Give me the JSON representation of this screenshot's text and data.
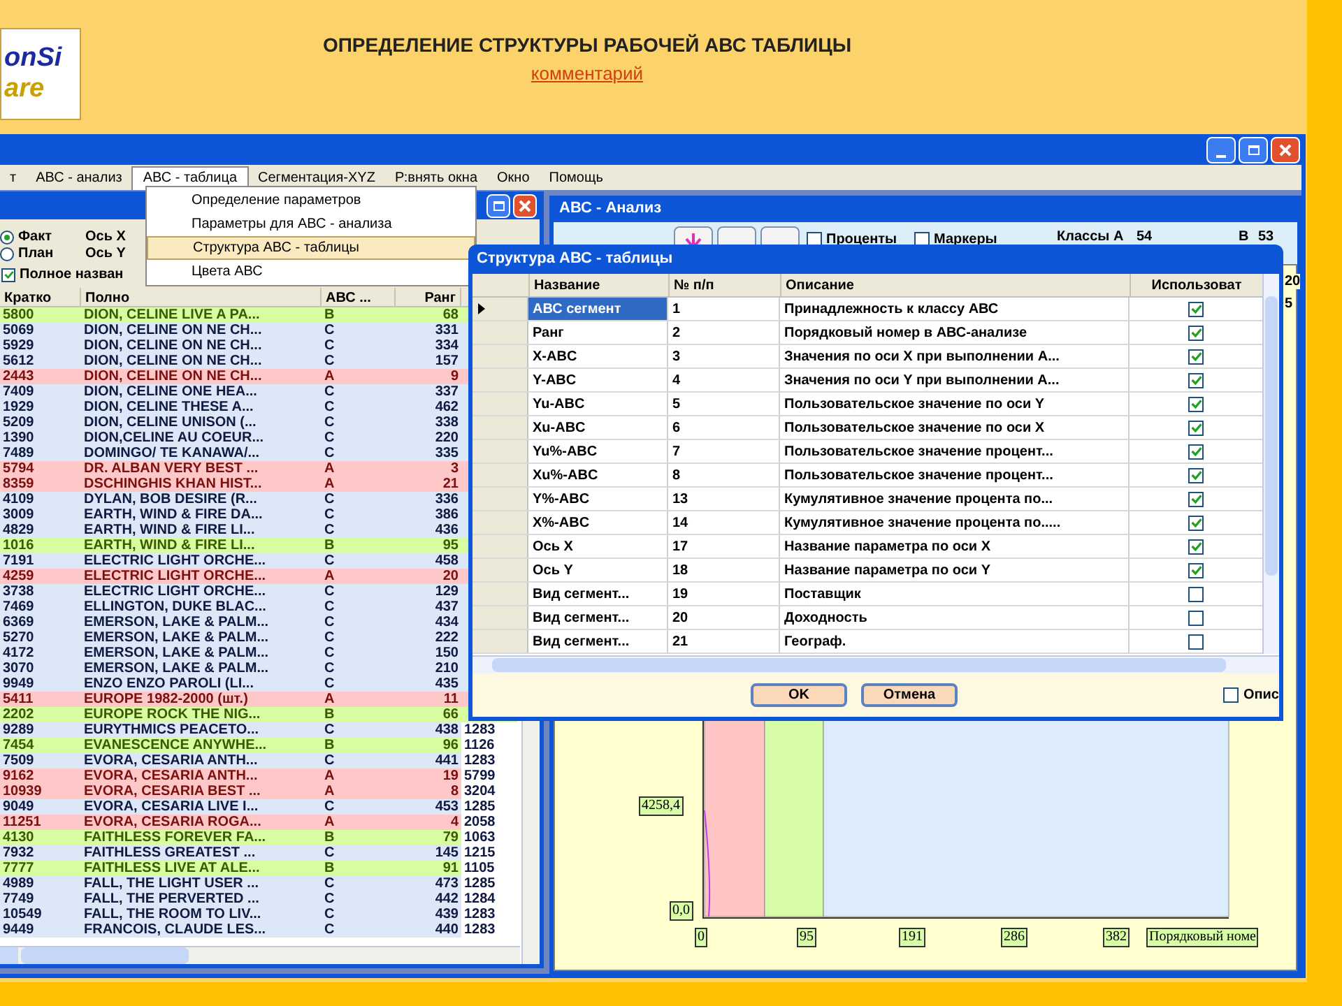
{
  "banner": {
    "logo_lines": [
      "onSi",
      "are"
    ],
    "title": "ОПРЕДЕЛЕНИЕ СТРУКТУРЫ РАБОЧЕЙ АВС ТАБЛИЦЫ",
    "link": "комментарий"
  },
  "menu": [
    {
      "label": "т",
      "selected": false
    },
    {
      "label": "АВС - анализ",
      "selected": false
    },
    {
      "label": "АВС - таблица",
      "selected": true
    },
    {
      "label": "Сегментация-XYZ",
      "selected": false
    },
    {
      "label": "Р:внять окна",
      "selected": false
    },
    {
      "label": "Окно",
      "selected": false
    },
    {
      "label": "Помощь",
      "selected": false
    }
  ],
  "dropdown": [
    {
      "label": "Определение параметров",
      "selected": false
    },
    {
      "label": "Параметры для АВС - анализа",
      "selected": false
    },
    {
      "label": "Структура АВС - таблицы",
      "selected": true
    },
    {
      "label": "Цвета АВС",
      "selected": false
    }
  ],
  "left_window": {
    "radios": [
      {
        "label": "Факт",
        "selected": true
      },
      {
        "label": "План",
        "selected": false
      }
    ],
    "axes": [
      "Ось X",
      "Ось Y"
    ],
    "full_name": {
      "label": "Полное назван",
      "checked": true
    },
    "columns": [
      "Кратко",
      "Полно",
      "АВС ...",
      "Ранг"
    ],
    "rows": [
      {
        "kind": "b",
        "cells": [
          "5800",
          "DION, CELINE LIVE A PA...",
          "B",
          "68"
        ]
      },
      {
        "kind": "c",
        "cells": [
          "5069",
          "DION, CELINE ON NE CH...",
          "C",
          "331"
        ]
      },
      {
        "kind": "c",
        "cells": [
          "5929",
          "DION, CELINE ON NE CH...",
          "C",
          "334"
        ]
      },
      {
        "kind": "c",
        "cells": [
          "5612",
          "DION, CELINE ON NE CH...",
          "C",
          "157"
        ]
      },
      {
        "kind": "a",
        "cells": [
          "2443",
          "DION, CELINE ON NE CH...",
          "A",
          "9"
        ]
      },
      {
        "kind": "c",
        "cells": [
          "7409",
          "DION, CELINE ONE HEA...",
          "C",
          "337"
        ]
      },
      {
        "kind": "c",
        "cells": [
          "1929",
          "DION, CELINE THESE A...",
          "C",
          "462"
        ]
      },
      {
        "kind": "c",
        "cells": [
          "5209",
          "DION, CELINE UNISON (...",
          "C",
          "338"
        ]
      },
      {
        "kind": "c",
        "cells": [
          "1390",
          "DION,CELINE AU COEUR...",
          "C",
          "220"
        ]
      },
      {
        "kind": "c",
        "cells": [
          "7489",
          "DOMINGO/ TE KANAWA/...",
          "C",
          "335"
        ]
      },
      {
        "kind": "a",
        "cells": [
          "5794",
          "DR. ALBAN VERY BEST ...",
          "A",
          "3"
        ]
      },
      {
        "kind": "a",
        "cells": [
          "8359",
          "DSCHINGHIS KHAN HIST...",
          "A",
          "21"
        ]
      },
      {
        "kind": "c",
        "cells": [
          "4109",
          "DYLAN, BOB DESIRE (R...",
          "C",
          "336"
        ]
      },
      {
        "kind": "c",
        "cells": [
          "3009",
          "EARTH, WIND & FIRE DA...",
          "C",
          "386"
        ]
      },
      {
        "kind": "c",
        "cells": [
          "4829",
          "EARTH, WIND & FIRE LI...",
          "C",
          "436"
        ]
      },
      {
        "kind": "b",
        "cells": [
          "1016",
          "EARTH, WIND & FIRE LI...",
          "B",
          "95"
        ]
      },
      {
        "kind": "c",
        "cells": [
          "7191",
          "ELECTRIC LIGHT ORCHE...",
          "C",
          "458"
        ]
      },
      {
        "kind": "a",
        "cells": [
          "4259",
          "ELECTRIC LIGHT ORCHE...",
          "A",
          "20"
        ]
      },
      {
        "kind": "c",
        "cells": [
          "3738",
          "ELECTRIC LIGHT ORCHE...",
          "C",
          "129"
        ]
      },
      {
        "kind": "c",
        "cells": [
          "7469",
          "ELLINGTON, DUKE BLAC...",
          "C",
          "437"
        ]
      },
      {
        "kind": "c",
        "cells": [
          "6369",
          "EMERSON, LAKE & PALM...",
          "C",
          "434"
        ]
      },
      {
        "kind": "c",
        "cells": [
          "5270",
          "EMERSON, LAKE & PALM...",
          "C",
          "222"
        ]
      },
      {
        "kind": "c",
        "cells": [
          "4172",
          "EMERSON, LAKE & PALM...",
          "C",
          "150"
        ]
      },
      {
        "kind": "c",
        "cells": [
          "3070",
          "EMERSON, LAKE & PALM...",
          "C",
          "210"
        ]
      },
      {
        "kind": "c",
        "cells": [
          "9949",
          "ENZO ENZO PAROLI (LI...",
          "C",
          "435"
        ]
      },
      {
        "kind": "a",
        "cells": [
          "5411",
          "EUROPE 1982-2000 (шт.)",
          "A",
          "11"
        ]
      },
      {
        "kind": "b",
        "cells": [
          "2202",
          "EUROPE ROCK THE NIG...",
          "B",
          "66"
        ]
      },
      {
        "kind": "c",
        "cells": [
          "9289",
          "EURYTHMICS PEACETO...",
          "C",
          "438",
          "1283"
        ]
      },
      {
        "kind": "b",
        "cells": [
          "7454",
          "EVANESCENCE ANYWHE...",
          "B",
          "96",
          "1126"
        ]
      },
      {
        "kind": "c",
        "cells": [
          "7509",
          "EVORA, CESARIA ANTH...",
          "C",
          "441",
          "1283"
        ]
      },
      {
        "kind": "a",
        "cells": [
          "9162",
          "EVORA, CESARIA ANTH...",
          "A",
          "19",
          "5799"
        ]
      },
      {
        "kind": "a",
        "cells": [
          "10939",
          "EVORA, CESARIA BEST ...",
          "A",
          "8",
          "3204"
        ]
      },
      {
        "kind": "c",
        "cells": [
          "9049",
          "EVORA, CESARIA LIVE I...",
          "C",
          "453",
          "1285"
        ]
      },
      {
        "kind": "a",
        "cells": [
          "11251",
          "EVORA, CESARIA ROGA...",
          "A",
          "4",
          "2058"
        ]
      },
      {
        "kind": "b",
        "cells": [
          "4130",
          "FAITHLESS FOREVER FA...",
          "B",
          "79",
          "1063"
        ]
      },
      {
        "kind": "c",
        "cells": [
          "7932",
          "FAITHLESS GREATEST ...",
          "C",
          "145",
          "1215"
        ]
      },
      {
        "kind": "b",
        "cells": [
          "7777",
          "FAITHLESS LIVE AT ALE...",
          "B",
          "91",
          "1105"
        ]
      },
      {
        "kind": "c",
        "cells": [
          "4989",
          "FALL, THE LIGHT USER ...",
          "C",
          "473",
          "1285"
        ]
      },
      {
        "kind": "c",
        "cells": [
          "7749",
          "FALL, THE PERVERTED ...",
          "C",
          "442",
          "1284"
        ]
      },
      {
        "kind": "c",
        "cells": [
          "10549",
          "FALL, THE ROOM TO LIV...",
          "C",
          "439",
          "1283"
        ]
      },
      {
        "kind": "c",
        "cells": [
          "9449",
          "FRANCOIS, CLAUDE LES...",
          "C",
          "440",
          "1283"
        ]
      }
    ]
  },
  "right_window": {
    "title": "АВС - Анализ",
    "checks": [
      {
        "label": "Проценты",
        "checked": false
      },
      {
        "label": "Маркеры",
        "checked": false
      }
    ],
    "classes_label": "Классы А",
    "class_a": "54",
    "class_b_label": "В",
    "class_b": "53",
    "edge_texts": [
      "20",
      "5"
    ],
    "y_labels": [
      "4258,4",
      "0,0"
    ],
    "x_labels": [
      "0",
      "95",
      "191",
      "286",
      "382"
    ],
    "x_title": "Порядковый номе"
  },
  "dialog": {
    "title": "Структура АВС - таблицы",
    "columns": [
      "Название",
      "№ п/п",
      "Описание",
      "Использоват"
    ],
    "rows": [
      {
        "name": "АВС сегмент",
        "num": "1",
        "desc": "Принадлежность к классу АВС",
        "checked": true,
        "selected": true
      },
      {
        "name": "Ранг",
        "num": "2",
        "desc": "Порядковый номер в АВС-анализе",
        "checked": true,
        "selected": false
      },
      {
        "name": "X-ABC",
        "num": "3",
        "desc": "Значения по оси X при выполнении А...",
        "checked": true,
        "selected": false
      },
      {
        "name": "Y-ABC",
        "num": "4",
        "desc": "Значения по оси Y при выполнении А...",
        "checked": true,
        "selected": false
      },
      {
        "name": "Yu-ABC",
        "num": "5",
        "desc": "Пользовательское значение по оси Y",
        "checked": true,
        "selected": false
      },
      {
        "name": "Xu-ABC",
        "num": "6",
        "desc": "Пользовательское значение по оси X",
        "checked": true,
        "selected": false
      },
      {
        "name": "Yu%-ABC",
        "num": "7",
        "desc": "Пользовательское значение процент...",
        "checked": true,
        "selected": false
      },
      {
        "name": "Xu%-ABC",
        "num": "8",
        "desc": "Пользовательское значение процент...",
        "checked": true,
        "selected": false
      },
      {
        "name": "Y%-ABC",
        "num": "13",
        "desc": "Кумулятивное значение процента по...",
        "checked": true,
        "selected": false
      },
      {
        "name": "X%-ABC",
        "num": "14",
        "desc": "Кумулятивное значение процента по.....",
        "checked": true,
        "selected": false
      },
      {
        "name": "Ось X",
        "num": "17",
        "desc": "Название параметра по оси X",
        "checked": true,
        "selected": false
      },
      {
        "name": "Ось Y",
        "num": "18",
        "desc": "Название параметра по оси Y",
        "checked": true,
        "selected": false
      },
      {
        "name": "Вид сегмент...",
        "num": "19",
        "desc": "Поставщик",
        "checked": false,
        "selected": false
      },
      {
        "name": "Вид сегмент...",
        "num": "20",
        "desc": "Доходность",
        "checked": false,
        "selected": false
      },
      {
        "name": "Вид сегмент...",
        "num": "21",
        "desc": "Географ.",
        "checked": false,
        "selected": false
      }
    ],
    "buttons": [
      "OK",
      "Отмена"
    ],
    "option": {
      "label": "Опис",
      "checked": false
    }
  }
}
